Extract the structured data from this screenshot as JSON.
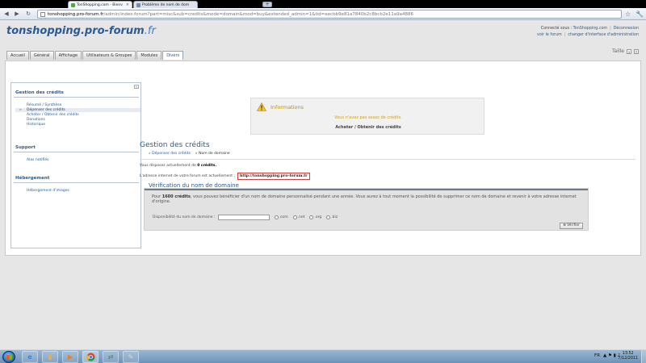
{
  "browser": {
    "tabs": [
      {
        "title": "TonShopping.com - Bienv",
        "close": "×"
      },
      {
        "title": "Problème de nom de dom",
        "close": "×"
      }
    ],
    "new_tab": "+",
    "back": "◀",
    "forward": "▶",
    "reload": "↻",
    "url_host": "tonshopping.pro-forum.fr",
    "url_path": "/admin/index.forum?part=misc&sub=credits&mode=domain&mod=buy&extended_admin=1&tid=eecbb9e81a7840b2c8bcb2e11a9a4886",
    "star": "☆",
    "wrench": "🔧"
  },
  "header": {
    "logo_main": "tonshopping.pro-forum",
    "logo_tld": ".fr",
    "connected_label": "Connecté sous : ",
    "username": "TonShopping.com",
    "logout": "Déconnexion",
    "view_forum": "voir le forum",
    "change_interface": "changer d'interface d'administration",
    "taille_label": "Taille",
    "size_small": "a",
    "size_large": "A"
  },
  "nav_tabs": [
    "Accueil",
    "Général",
    "Affichage",
    "Utilisateurs & Groupes",
    "Modules",
    "Divers"
  ],
  "sidebar": {
    "collapse": "«",
    "sections": [
      {
        "title": "Gestion des crédits",
        "items": [
          "Résumé / Synthèse",
          "Dépenser des crédits",
          "Acheter / Obtenir des crédits",
          "Donations",
          "Historique"
        ]
      },
      {
        "title": "Support",
        "items": [
          "Alas notifiés"
        ]
      },
      {
        "title": "Hébergement",
        "items": [
          "Hébergement d'images"
        ]
      }
    ]
  },
  "info_box": {
    "title": "Informations",
    "message": "Vous n'avez pas assez de crédits.",
    "link": "Acheter / Obtenir des crédits"
  },
  "main": {
    "title": "Gestion des crédits",
    "breadcrumb_1": "» Dépenser des crédits",
    "breadcrumb_2": "» Nom de domaine",
    "credits_text": "Vous disposez actuellement de ",
    "credits_value": "0 crédits.",
    "address_label": "L'adresse internet de votre forum est actuellement :",
    "address_value": "http://tonshopping.pro-forum.fr"
  },
  "verification": {
    "title": "Vérification du nom de domaine",
    "text_pre": "Pour ",
    "text_bold": "1600 crédits",
    "text_post": ", vous pouvez bénéficier d'un nom de domaine personnalisé pendant une année. Vous aurez à tout moment la possibilité de supprimer ce nom de domaine et revenir à votre adresse internet d'origine.",
    "field_label": "Disponibilité du nom de domaine :",
    "tlds": [
      ".com",
      ".net",
      ".org",
      ".biz"
    ],
    "verify_button": "Vérifier",
    "verify_icon": "⊕"
  },
  "taskbar": {
    "lang": "FR",
    "tray_icons": "▲ ⚑ ▮ ♪",
    "time": "13:52",
    "date": "7/12/2011"
  },
  "colors": {
    "accent": "#2c5a92",
    "warning": "#c09000",
    "highlight_border": "#d0433a"
  }
}
